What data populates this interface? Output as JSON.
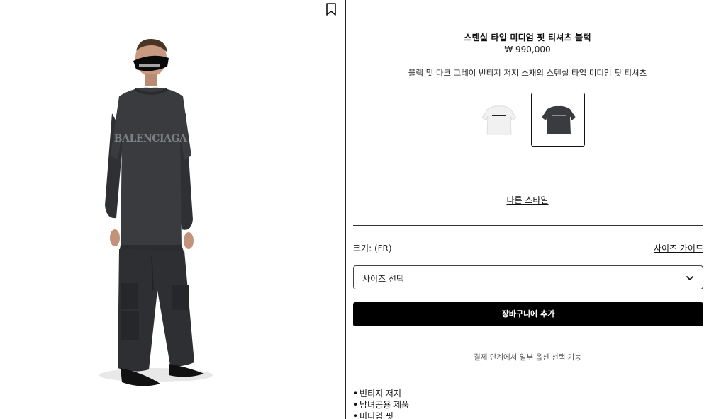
{
  "product": {
    "title": "스텐실 타입 미디엄 핏 티셔츠 블랙",
    "price": "₩ 990,000",
    "description": "블랙 및 다크 그레이 빈티지 저지 소재의 스텐실 타입 미디엄 핏 티셔츠",
    "shirt_print": "BALENCIAGA"
  },
  "swatches": [
    {
      "color_name": "white",
      "shirt_color": "#f1f1f1",
      "print_color": "#222222",
      "selected": false
    },
    {
      "color_name": "black",
      "shirt_color": "#3a3b3e",
      "print_color": "#8a8c90",
      "selected": true
    }
  ],
  "links": {
    "other_style": "다른 스타일",
    "size_guide": "사이즈 가이드"
  },
  "size": {
    "label": "크기: (FR)",
    "select_value": "사이즈 선택"
  },
  "cart": {
    "button_label": "장바구니에 추가"
  },
  "note": "결제 단계에서 일부 옵션 선택 기능",
  "features": [
    "빈티지 저지",
    "남녀공용 제품",
    "미디엄 핏"
  ],
  "colors": {
    "button_bg": "#000000",
    "text": "#111111",
    "divider": "#222222"
  },
  "icons": {
    "bookmark": "bookmark-icon",
    "select_arrow": "chevron-down-icon"
  }
}
